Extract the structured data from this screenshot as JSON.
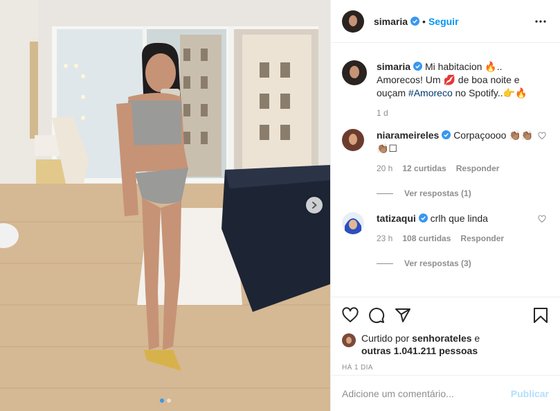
{
  "post": {
    "username": "simaria",
    "follow_label": "Seguir",
    "separator": "•",
    "more_icon": "more-horizontal-icon",
    "verified_icon": "verified-badge-icon"
  },
  "caption": {
    "username": "simaria",
    "text_part1": "Mi habitacion 🔥.. Amorecos! Um 💋 de boa noite e ouçam ",
    "hashtag": "#Amoreco",
    "text_part2": " no Spotify..👉🔥",
    "time": "1 d"
  },
  "comments": [
    {
      "username": "niarameireles",
      "text": "Corpaçoooo 👏🏽👏🏽👏🏽☐",
      "time": "20 h",
      "likes": "12 curtidas",
      "reply_label": "Responder",
      "view_replies": "Ver respostas (1)"
    },
    {
      "username": "tatizaqui",
      "text": "crlh que linda",
      "time": "23 h",
      "likes": "108 curtidas",
      "reply_label": "Responder",
      "view_replies": "Ver respostas (3)"
    }
  ],
  "actions": {
    "like_icon": "heart-icon",
    "comment_icon": "comment-icon",
    "share_icon": "share-icon",
    "save_icon": "bookmark-icon"
  },
  "likes": {
    "prefix": "Curtido por ",
    "user": "senhorateles",
    "middle": " e",
    "others": "outras 1.041.211 pessoas"
  },
  "posted_ago": "HÁ 1 DIA",
  "add_comment": {
    "placeholder": "Adicione um comentário...",
    "publish_label": "Publicar"
  },
  "carousel": {
    "current": 1,
    "total": 2
  },
  "colors": {
    "link": "#0095f6",
    "verified": "#3897f0",
    "muted": "#8e8e8e",
    "publish_disabled": "#b2dffc"
  }
}
